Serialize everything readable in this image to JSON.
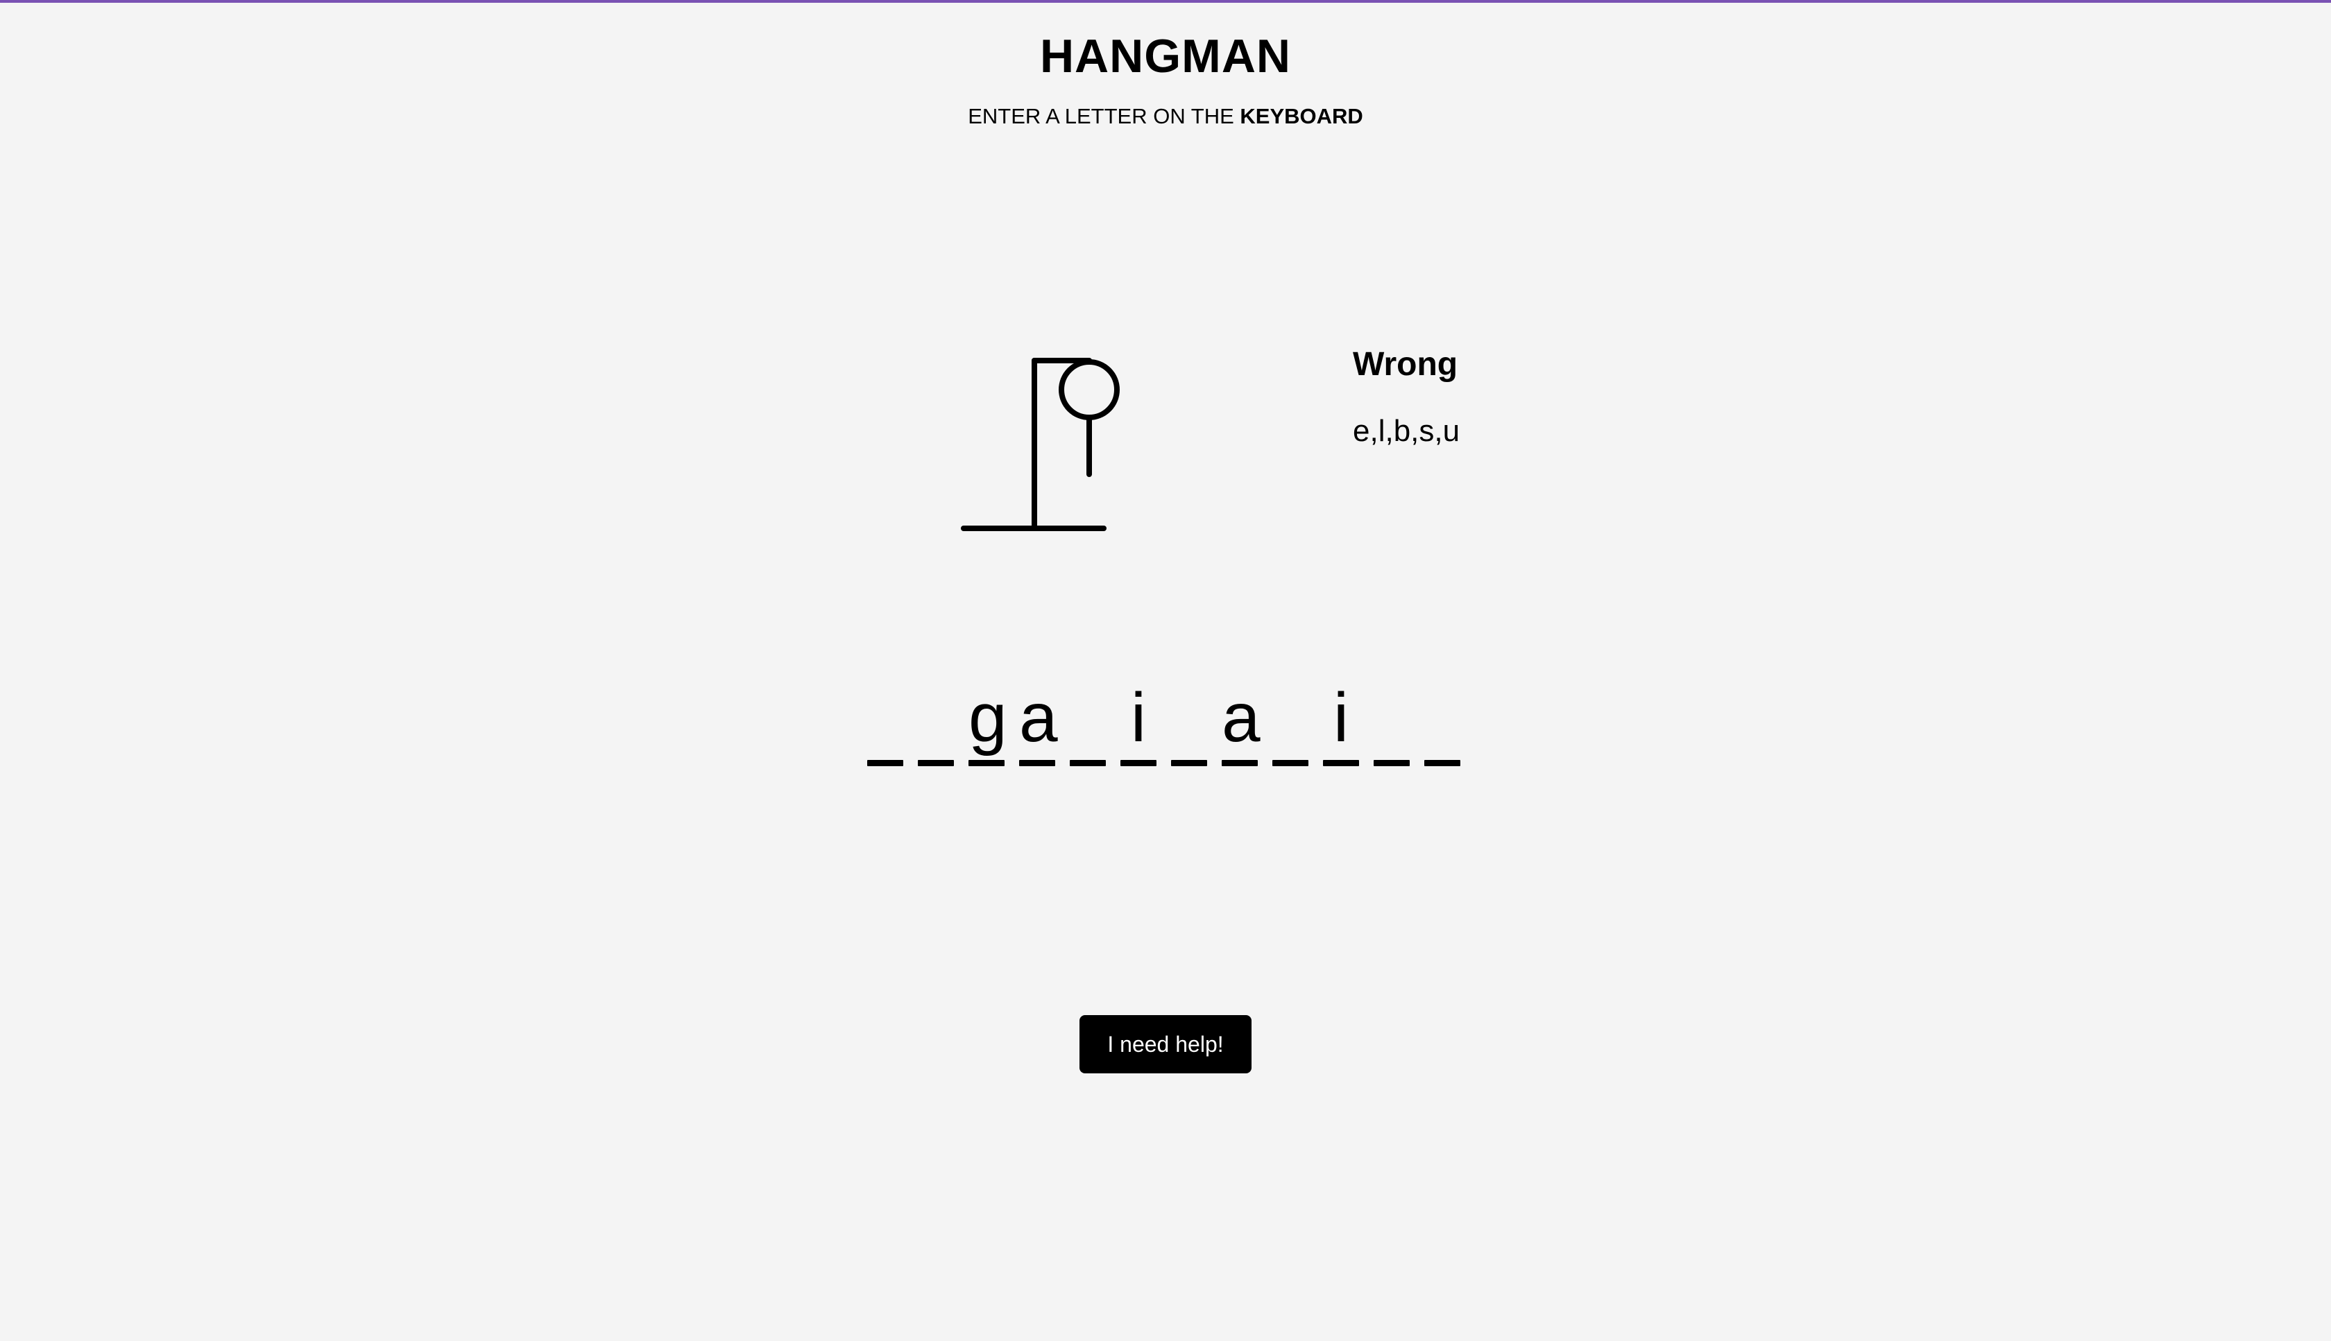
{
  "header": {
    "title": "HANGMAN",
    "instruction_prefix": "ENTER A LETTER ON THE ",
    "instruction_emphasis": "KEYBOARD"
  },
  "wrong": {
    "title": "Wrong",
    "letters": "e,l,b,s,u"
  },
  "word": {
    "letters": [
      "",
      "",
      "g",
      "a",
      "",
      "i",
      "",
      "a",
      "",
      "i",
      "",
      ""
    ]
  },
  "help_button": {
    "label": "I need help!"
  },
  "colors": {
    "background": "#f4f4f4",
    "accent_bar": "#7a52b3",
    "ink": "#000000",
    "button_text": "#ffffff"
  }
}
